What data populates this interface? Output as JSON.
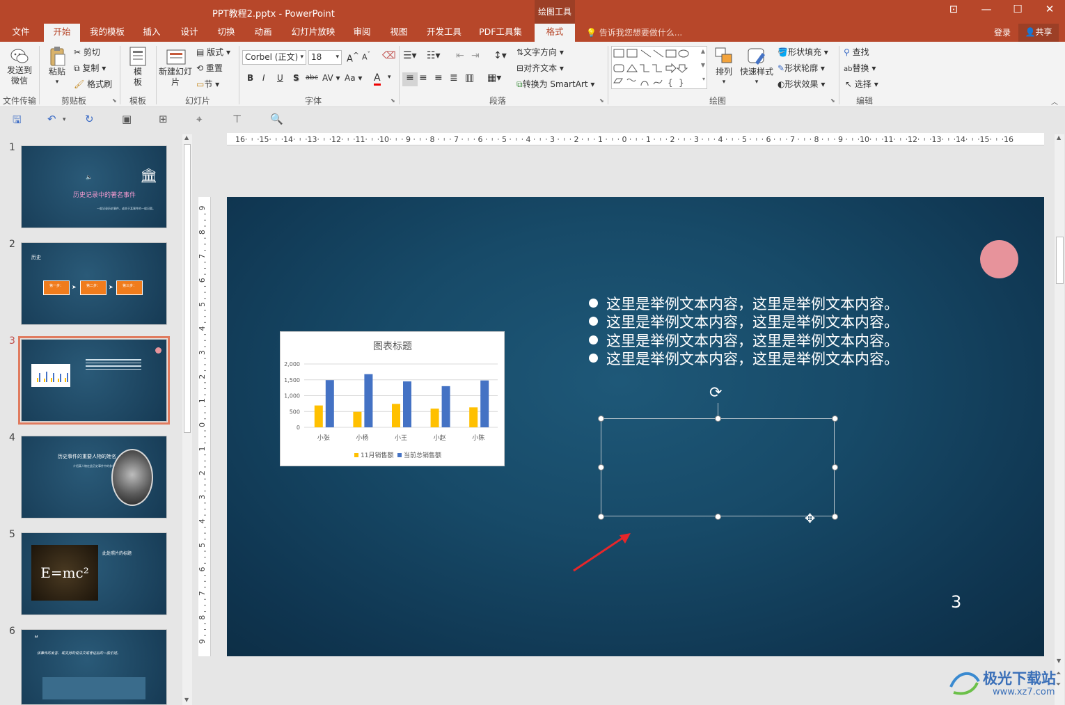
{
  "window": {
    "title": "PPT教程2.pptx - PowerPoint",
    "context_header": "绘图工具"
  },
  "tabs": [
    "文件",
    "开始",
    "我的模板",
    "插入",
    "设计",
    "切换",
    "动画",
    "幻灯片放映",
    "审阅",
    "视图",
    "开发工具",
    "PDF工具集",
    "格式"
  ],
  "tell_me": "告诉我您想要做什么...",
  "account": {
    "login": "登录",
    "share": "共享"
  },
  "ribbon": {
    "file_transfer": {
      "button": "发送到微信",
      "group": "文件传输"
    },
    "clipboard": {
      "paste": "粘贴",
      "cut": "剪切",
      "copy": "复制",
      "format_painter": "格式刷",
      "group": "剪贴板"
    },
    "template": {
      "button": "模板",
      "group": "模板"
    },
    "slides": {
      "new_slide": "新建幻灯片",
      "layout": "版式",
      "reset": "重置",
      "section": "节",
      "group": "幻灯片"
    },
    "font": {
      "name": "Corbel (正文)",
      "size": "18",
      "group": "字体",
      "buttons": [
        "B",
        "I",
        "U",
        "S",
        "abc",
        "AV",
        "Aa",
        "A"
      ]
    },
    "paragraph": {
      "text_direction": "文字方向",
      "align_text": "对齐文本",
      "convert_smartart": "转换为 SmartArt",
      "group": "段落"
    },
    "drawing": {
      "arrange": "排列",
      "quick_styles": "快速样式",
      "shape_fill": "形状填充",
      "shape_outline": "形状轮廓",
      "shape_effects": "形状效果",
      "group": "绘图"
    },
    "editing": {
      "find": "查找",
      "replace": "替换",
      "select": "选择",
      "group": "编辑"
    }
  },
  "thumbnails": [
    {
      "num": "1",
      "title": "历史记录中的著名事件",
      "sub": "一般记录历史事件，或关于某事件的一般记载。"
    },
    {
      "num": "2",
      "title": "历史",
      "steps": [
        "第一步：",
        "第二步：",
        "第三步："
      ]
    },
    {
      "num": "3",
      "title": ""
    },
    {
      "num": "4",
      "title": "历史事件的重要人物的姓名",
      "sub": "介绍某人物在此历史事件中的参与。"
    },
    {
      "num": "5",
      "title": "此处照片的标题",
      "formula": "E=mc²"
    },
    {
      "num": "6",
      "title": "该事件的发言、或支持的说法文或考证后的一般引述。"
    }
  ],
  "ruler_h": [
    "16",
    "15",
    "14",
    "13",
    "12",
    "11",
    "10",
    "9",
    "8",
    "7",
    "6",
    "5",
    "4",
    "3",
    "2",
    "1",
    "0",
    "1",
    "2",
    "3",
    "4",
    "5",
    "6",
    "7",
    "8",
    "9",
    "10",
    "11",
    "12",
    "13",
    "14",
    "15",
    "16"
  ],
  "ruler_v": [
    "9",
    "8",
    "7",
    "6",
    "5",
    "4",
    "3",
    "2",
    "1",
    "0",
    "1",
    "2",
    "3",
    "4",
    "5",
    "6",
    "7",
    "8",
    "9"
  ],
  "slide": {
    "bullets": [
      "这里是举例文本内容，这里是举例文本内容。",
      "这里是举例文本内容，这里是举例文本内容。",
      "这里是举例文本内容，这里是举例文本内容。",
      "这里是举例文本内容，这里是举例文本内容。"
    ],
    "page_number": "3",
    "circle_color": "#e7939b"
  },
  "chart_data": {
    "type": "bar",
    "title": "图表标题",
    "categories": [
      "小张",
      "小杨",
      "小王",
      "小赵",
      "小陈"
    ],
    "series": [
      {
        "name": "11月销售额",
        "color": "#ffc000",
        "values": [
          690,
          490,
          740,
          590,
          630
        ]
      },
      {
        "name": "当前总销售额",
        "color": "#4472c4",
        "values": [
          1490,
          1680,
          1450,
          1300,
          1480
        ]
      }
    ],
    "ylim": [
      0,
      2000
    ],
    "yticks": [
      "0",
      "500",
      "1,000",
      "1,500",
      "2,000"
    ],
    "legend_position": "bottom"
  },
  "watermark": {
    "text": "极光下载站",
    "url": "www.xz7.com"
  }
}
